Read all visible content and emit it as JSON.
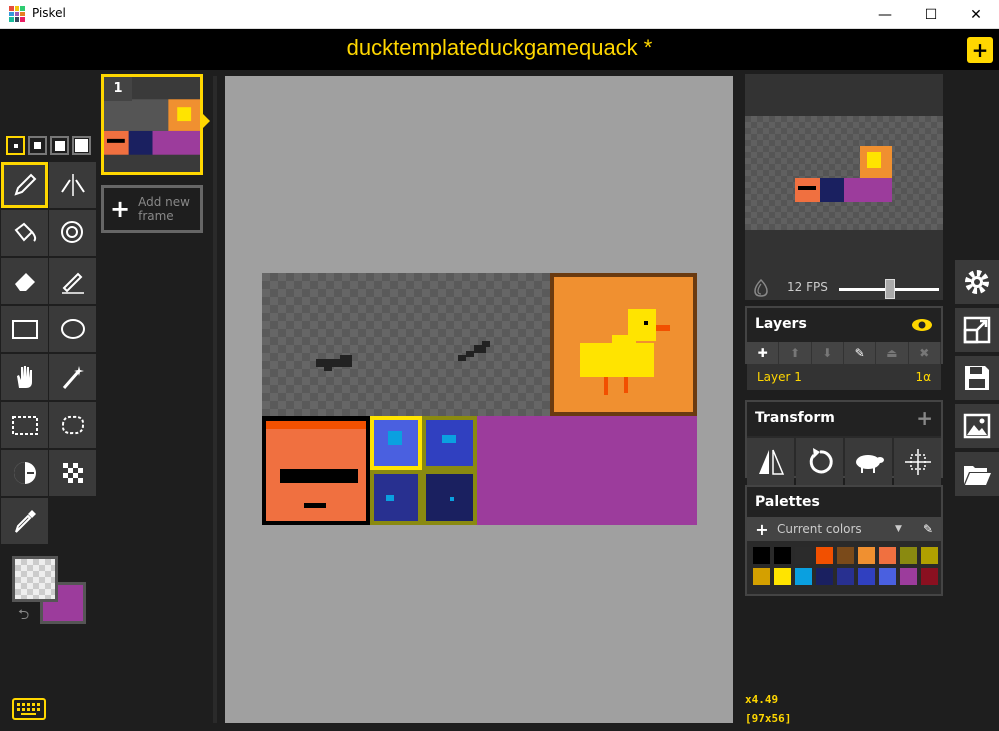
{
  "window": {
    "app_name": "Piskel",
    "minimize": "—",
    "maximize": "☐",
    "close": "✕"
  },
  "header": {
    "title": "ducktemplateduckgamequack *",
    "action_label": "+"
  },
  "frames": {
    "items": [
      {
        "number": "1"
      }
    ],
    "add_label_line1": "Add new",
    "add_label_line2": "frame"
  },
  "preview": {
    "fps_label": "12 FPS",
    "fps_value": 12
  },
  "layers": {
    "title": "Layers",
    "items": [
      {
        "name": "Layer 1",
        "opacity": "1α"
      }
    ]
  },
  "transform": {
    "title": "Transform",
    "add": "+"
  },
  "palettes": {
    "title": "Palettes",
    "add": "+",
    "selected": "Current colors",
    "caret": "▼",
    "colors": [
      "#000000",
      "#000000",
      "#2b2b2b",
      "#f25000",
      "#7a4a1a",
      "#f09030",
      "#f07040",
      "#8a8a10",
      "#b0a000",
      "#d4a000",
      "#ffe400",
      "#0aa0e0",
      "#1a2060",
      "#283090",
      "#3040c0",
      "#4a60e0",
      "#9c3c9c",
      "#8a1020"
    ]
  },
  "status": {
    "zoom": "x4.49",
    "size": "[97x56]"
  },
  "colors": {
    "accent": "#ffd700",
    "secondary_color": "#9c3c9c",
    "canvas_bg": "#a0a0a0"
  }
}
